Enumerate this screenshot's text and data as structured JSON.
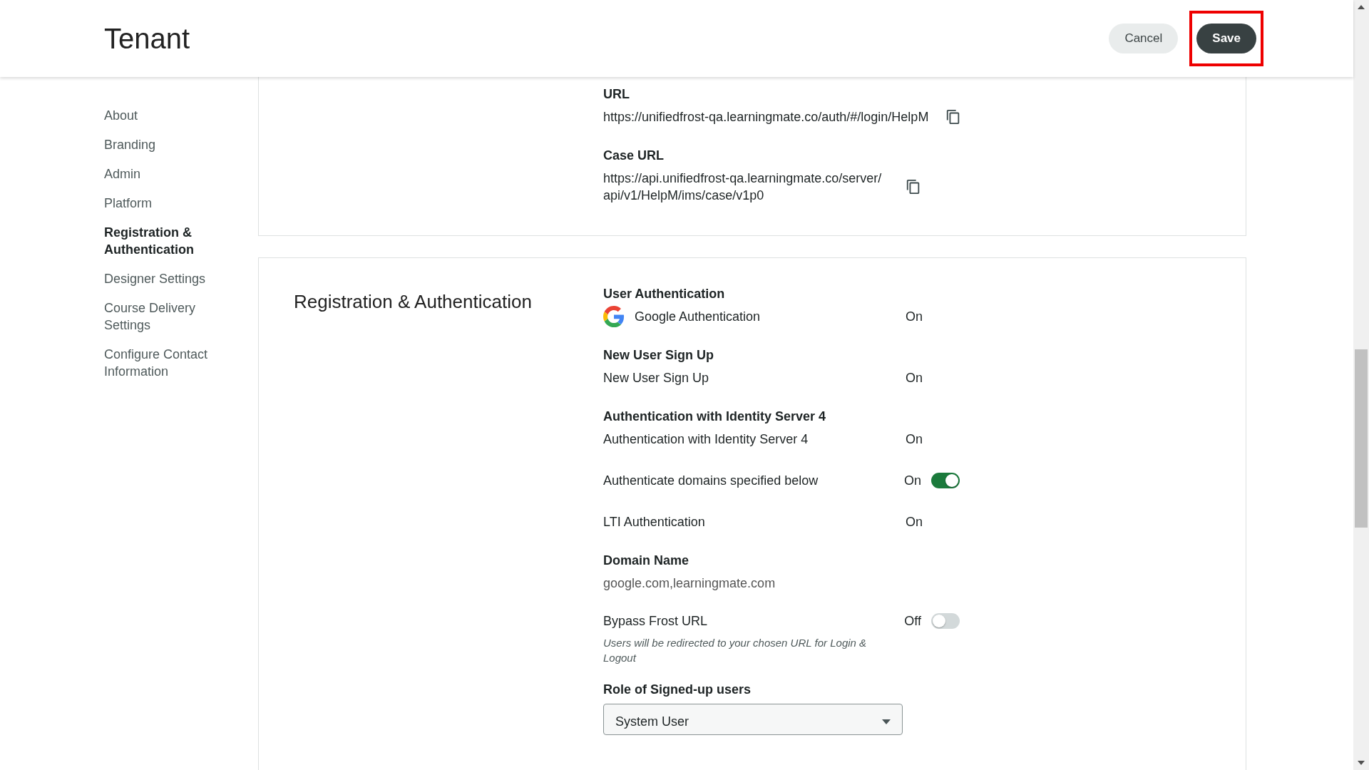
{
  "header": {
    "title": "Tenant",
    "buttons": [
      {
        "label": "Cancel",
        "kind": "secondary",
        "highlighted": false
      },
      {
        "label": "Save",
        "kind": "primary",
        "highlighted": true
      }
    ]
  },
  "sidebar": {
    "items": [
      {
        "label": "About",
        "selected": false
      },
      {
        "label": "Branding",
        "selected": false
      },
      {
        "label": "Admin",
        "selected": false
      },
      {
        "label": "Platform",
        "selected": false
      },
      {
        "label": "Registration & Authentication",
        "selected": true
      },
      {
        "label": "Designer Settings",
        "selected": false
      },
      {
        "label": "Course Delivery Settings",
        "selected": false
      },
      {
        "label": "Configure Contact Information",
        "selected": false
      }
    ]
  },
  "links_card": {
    "fields": [
      {
        "label": "URL",
        "value": "https://unifiedfrost-qa.learningmate.co/auth/#/login/HelpM"
      },
      {
        "label": "Case URL",
        "value": "https://api.unifiedfrost-qa.learningmate.co/server/api/v1/HelpM/ims/case/v1p0"
      }
    ]
  },
  "registration": {
    "title": "Registration & Authentication",
    "items": [
      {
        "kind": "heading",
        "text": "User Authentication"
      },
      {
        "kind": "provider",
        "label": "Google Authentication",
        "status": "On"
      },
      {
        "kind": "heading",
        "text": "New User Sign Up"
      },
      {
        "kind": "status",
        "label": "New User Sign Up",
        "status": "On"
      },
      {
        "kind": "heading",
        "text": "Authentication with Identity Server 4"
      },
      {
        "kind": "status",
        "label": "Authentication with Identity Server 4",
        "status": "On"
      },
      {
        "kind": "toggle",
        "label": "Authenticate domains specified below",
        "status": "On",
        "on": true
      },
      {
        "kind": "status",
        "label": "LTI Authentication",
        "status": "On"
      },
      {
        "kind": "heading",
        "text": "Domain Name"
      },
      {
        "kind": "value",
        "text": "google.com,learningmate.com"
      },
      {
        "kind": "toggle",
        "label": "Bypass Frost URL",
        "status": "Off",
        "on": false,
        "note": "Users will be redirected to your chosen URL for Login & Logout"
      },
      {
        "kind": "heading",
        "text": "Role of Signed-up users"
      },
      {
        "kind": "select",
        "value": "System User"
      }
    ]
  }
}
